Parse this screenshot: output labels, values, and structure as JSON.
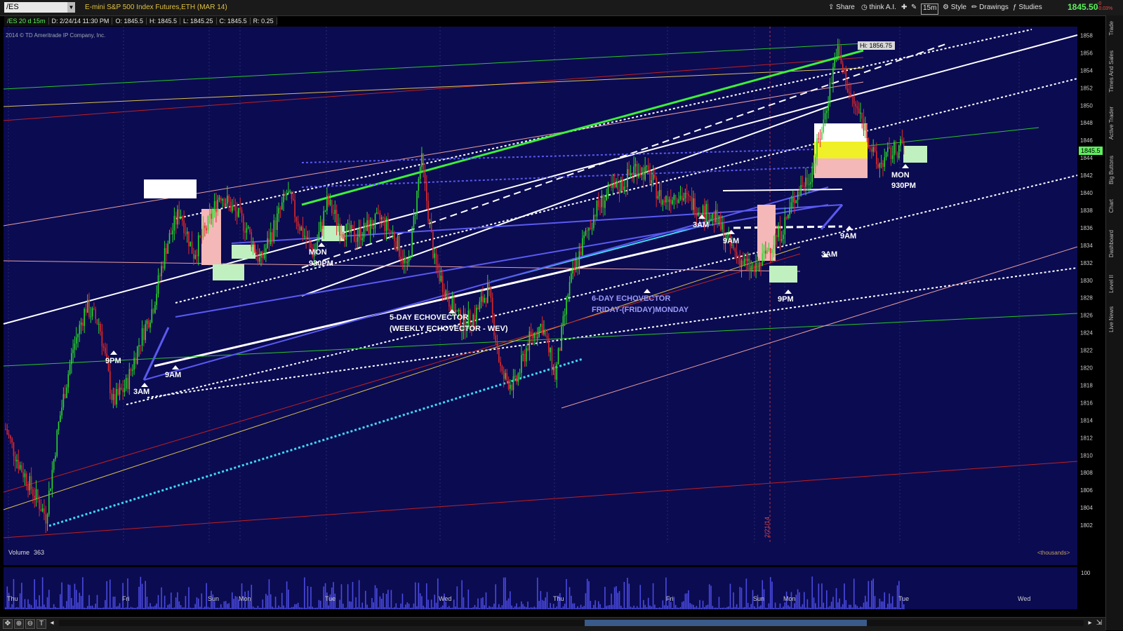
{
  "toolbar": {
    "symbol": "/ES",
    "symbol_description": "E-mini S&P 500 Index Futures,ETH (MAR 14)",
    "share_label": "Share",
    "think_label": "think A.I.",
    "interval_label": "15m",
    "style_label": "Style",
    "drawings_label": "Drawings",
    "studies_label": "Studies",
    "last_price": "1845.50",
    "change_top": "-0",
    "change_bottom": "-0.03%"
  },
  "info_bar": {
    "chart_spec": "/ES 20 d 15m",
    "date": "D: 2/24/14 11:30 PM",
    "open": "O: 1845.5",
    "high": "H: 1845.5",
    "low": "L: 1845.25",
    "close": "C: 1845.5",
    "range": "R: 0.25"
  },
  "side_tabs": [
    "Trade",
    "Times And Sales",
    "Active Trader",
    "Big Buttons",
    "Chart",
    "Dashboard",
    "Level II",
    "Live News"
  ],
  "chart_data": {
    "type": "candlestick",
    "copyright": "2014 © TD Ameritrade IP Company, Inc.",
    "ylim": [
      1800,
      1859
    ],
    "y_ticks": [
      1802,
      1804,
      1806,
      1808,
      1810,
      1812,
      1814,
      1816,
      1818,
      1820,
      1822,
      1824,
      1826,
      1828,
      1830,
      1832,
      1834,
      1836,
      1838,
      1840,
      1842,
      1844,
      1846,
      1848,
      1850,
      1852,
      1854,
      1856,
      1858
    ],
    "x_labels": [
      "Thu",
      "Fri",
      "Sun",
      "Mon",
      "Tue",
      "Wed",
      "Thu",
      "Fri",
      "Sun",
      "Mon",
      "Tue",
      "Wed"
    ],
    "current_price_label": "1845.5",
    "high_label": "Hi: 1856.75",
    "date_marker_label": "2/21/14",
    "price_path": [
      1813,
      1809,
      1806,
      1803,
      1814,
      1822,
      1827,
      1825,
      1816,
      1818,
      1823,
      1827,
      1834,
      1838,
      1833,
      1836,
      1840,
      1838,
      1836,
      1832,
      1836,
      1840,
      1836,
      1833,
      1839,
      1836,
      1835,
      1836,
      1837,
      1835,
      1831,
      1844,
      1832,
      1828,
      1825,
      1826,
      1829,
      1819,
      1818,
      1823,
      1825,
      1819,
      1829,
      1834,
      1838,
      1840,
      1841,
      1843,
      1842,
      1839,
      1840,
      1839,
      1838,
      1837,
      1834,
      1832,
      1831,
      1834,
      1836,
      1840,
      1842,
      1848,
      1856.5,
      1851,
      1848,
      1843,
      1844.5,
      1845.5
    ],
    "annotations": [
      "9PM",
      "3AM",
      "9AM",
      "MON",
      "930PM",
      "5-DAY ECHOVECTOR",
      "(WEEKLY ECHOVECTOR - WEV)",
      "6-DAY ECHOVECTOR",
      "FRIDAY-(FRIDAY)MONDAY",
      "3AM",
      "9AM",
      "9PM",
      "3AM",
      "9AM",
      "MON",
      "930PM"
    ],
    "volume_panel": {
      "label": "Volume",
      "value": "363",
      "unit_label": "<thousands>",
      "y_tick": "100"
    }
  },
  "colors": {
    "background": "#0b0b52",
    "up": "#2bd82b",
    "down": "#e02828",
    "grid": "#2a2a6a"
  }
}
